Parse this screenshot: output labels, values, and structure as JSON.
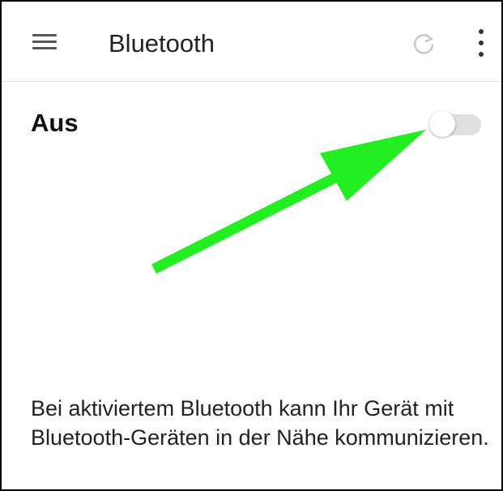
{
  "app_bar": {
    "title": "Bluetooth",
    "menu_icon": "hamburger-menu-icon",
    "refresh_icon": "refresh-icon",
    "more_icon": "more-vertical-icon"
  },
  "bluetooth_toggle": {
    "label": "Aus",
    "state": "off"
  },
  "description": "Bei aktiviertem Bluetooth kann Ihr Gerät mit Bluetooth-Geräten in der Nähe kommunizieren.",
  "colors": {
    "arrow": "#22ee22",
    "switch_track_off": "#e0e0e0",
    "switch_thumb": "#ffffff"
  }
}
